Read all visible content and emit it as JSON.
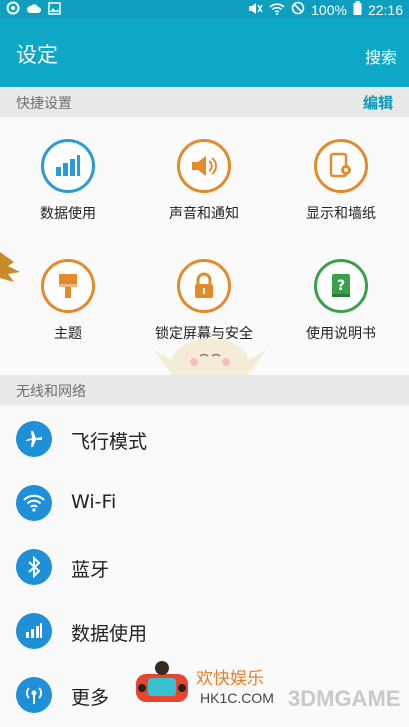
{
  "status_bar": {
    "battery": "100%",
    "time": "22:16"
  },
  "header": {
    "title": "设定",
    "search_label": "搜索"
  },
  "quick_settings": {
    "section_label": "快捷设置",
    "edit_label": "编辑",
    "items": [
      {
        "label": "数据使用",
        "icon": "data-usage-icon"
      },
      {
        "label": "声音和通知",
        "icon": "sound-icon"
      },
      {
        "label": "显示和墙纸",
        "icon": "display-icon"
      },
      {
        "label": "主题",
        "icon": "theme-brush-icon"
      },
      {
        "label": "锁定屏幕与安全",
        "icon": "lock-icon"
      },
      {
        "label": "使用说明书",
        "icon": "help-book-icon"
      }
    ]
  },
  "network": {
    "section_label": "无线和网络",
    "items": [
      {
        "label": "飞行模式",
        "icon": "airplane-icon"
      },
      {
        "label": "Wi-Fi",
        "icon": "wifi-icon"
      },
      {
        "label": "蓝牙",
        "icon": "bluetooth-icon"
      },
      {
        "label": "数据使用",
        "icon": "data-usage-icon"
      },
      {
        "label": "更多",
        "icon": "more-connections-icon"
      }
    ]
  },
  "watermark": {
    "cn_text": "欢快娱乐",
    "site": "HK1C.COM",
    "brand": "3DMGAME"
  },
  "colors": {
    "appbar": "#0fa7c6",
    "accent": "#0e98b8",
    "list_icon": "#1f8fd8"
  }
}
